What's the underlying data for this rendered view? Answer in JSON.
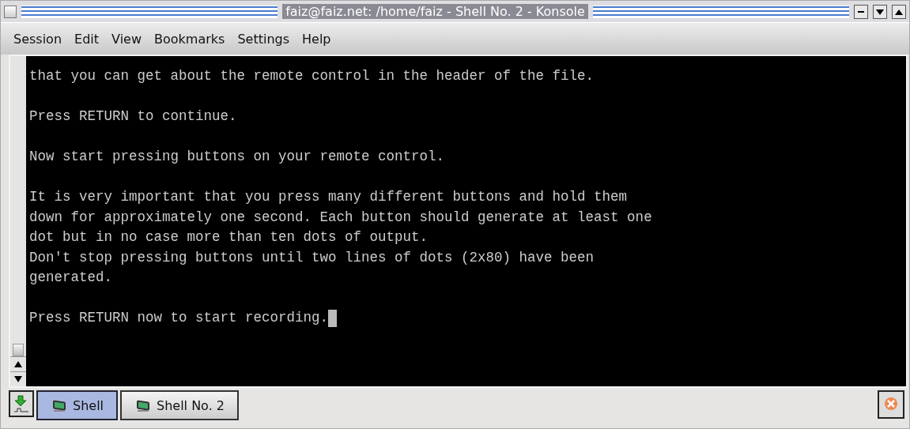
{
  "window": {
    "title": "faiz@faiz.net: /home/faiz - Shell No. 2 - Konsole"
  },
  "menu": [
    "Session",
    "Edit",
    "View",
    "Bookmarks",
    "Settings",
    "Help"
  ],
  "terminal": {
    "paragraphs": [
      [
        "that you can get about the remote control in the header of the file."
      ],
      [
        "Press RETURN to continue."
      ],
      [
        "Now start pressing buttons on your remote control."
      ],
      [
        "It is very important that you press many different buttons and hold them",
        "down for approximately one second. Each button should generate at least one",
        "dot but in no case more than ten dots of output.",
        "Don't stop pressing buttons until two lines of dots (2x80) have been",
        "generated."
      ],
      [
        "Press RETURN now to start recording."
      ]
    ],
    "cursor": true
  },
  "tabs": [
    {
      "label": "Shell",
      "selected": true
    },
    {
      "label": "Shell No. 2",
      "selected": false
    }
  ]
}
